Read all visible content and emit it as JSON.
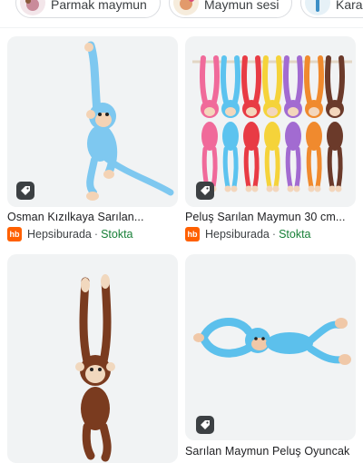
{
  "chips": [
    {
      "label": "Parmak maymun"
    },
    {
      "label": "Maymun sesi"
    },
    {
      "label": "Kara"
    }
  ],
  "results": [
    {
      "title": "Osman Kızılkaya Sarılan...",
      "seller": "Hepsiburada",
      "separator": "·",
      "stock": "Stokta",
      "seller_badge": "hb",
      "toy_colors": [
        "#7ec8f0"
      ]
    },
    {
      "title": "Peluş Sarılan Maymun 30 cm...",
      "seller": "Hepsiburada",
      "separator": "·",
      "stock": "Stokta",
      "seller_badge": "hb",
      "toy_colors": [
        "#f06a9a",
        "#5cc3ef",
        "#e83b44",
        "#f5d33a",
        "#a26bd1",
        "#f08a2e",
        "#6b3a2a"
      ]
    },
    {
      "title": "",
      "seller": "",
      "separator": "",
      "stock": "",
      "seller_badge": "",
      "toy_colors": [
        "#7a3b1f"
      ]
    },
    {
      "title": "Sarılan Maymun Peluş Oyuncak",
      "seller": "",
      "separator": "",
      "stock": "",
      "seller_badge": "",
      "toy_colors": [
        "#5cc0ec"
      ]
    }
  ],
  "colors": {
    "stock": "#188038",
    "seller_badge_bg": "#ff6000",
    "tag_bg": "#3c4043"
  },
  "icons": {
    "tag": "price-tag-icon"
  }
}
